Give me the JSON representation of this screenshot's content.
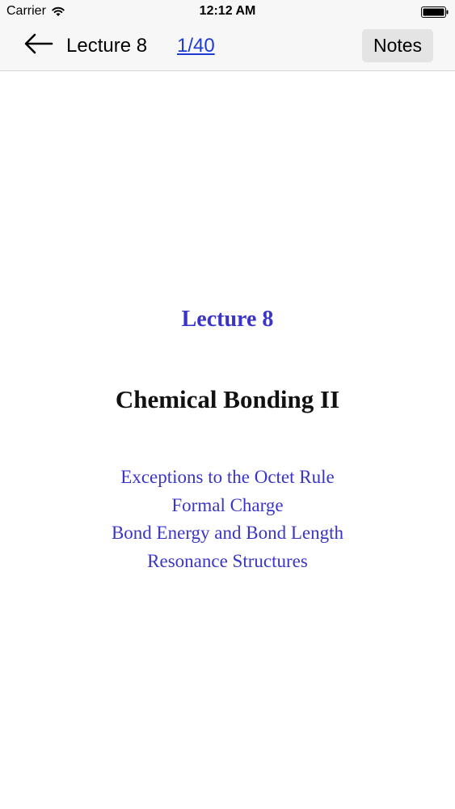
{
  "status_bar": {
    "carrier": "Carrier",
    "time": "12:12 AM"
  },
  "nav": {
    "title": "Lecture 8",
    "page_counter": "1/40",
    "notes_label": "Notes"
  },
  "slide": {
    "heading": "Lecture 8",
    "title": "Chemical Bonding II",
    "topics": [
      "Exceptions to the Octet Rule",
      "Formal Charge",
      "Bond Energy and Bond Length",
      "Resonance Structures"
    ]
  },
  "colors": {
    "slide_accent": "#3a35c8",
    "link": "#1f3bd6",
    "nav_background": "#f7f7f7"
  },
  "icons": {
    "back": "arrow-left-icon",
    "wifi": "wifi-icon",
    "battery": "battery-icon"
  }
}
